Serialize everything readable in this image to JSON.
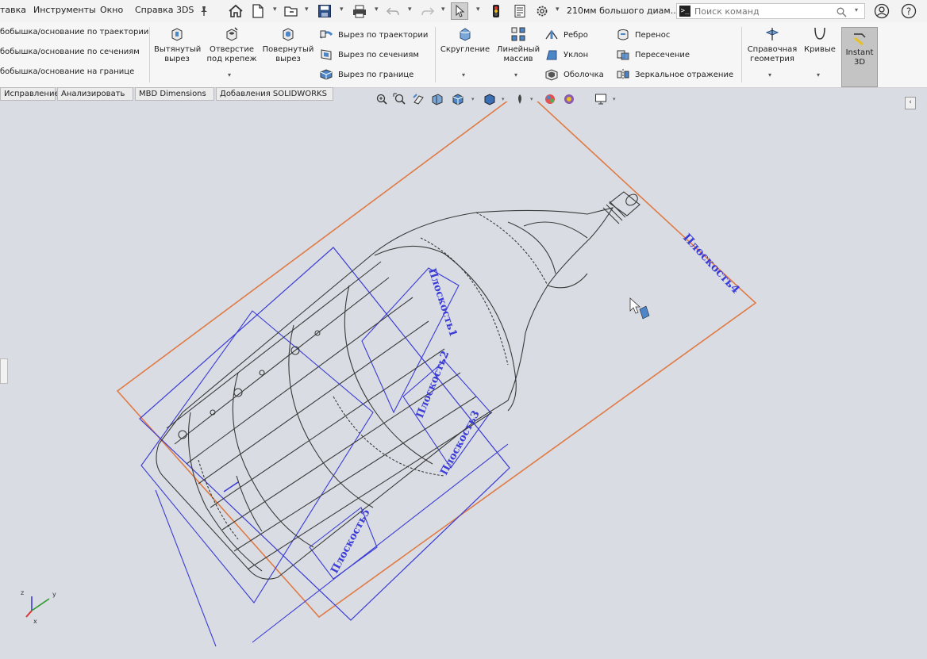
{
  "menu": [
    "тавка",
    "Инструменты",
    "Окно",
    "Справка 3DS"
  ],
  "document_title": "210мм большого диам...",
  "search": {
    "placeholder": "Поиск команд"
  },
  "ribbon": {
    "boss_items": [
      "бобышка/основание по траектории",
      "бобышка/основание по сечениям",
      "бобышка/основание на границе"
    ],
    "extruded_cut": [
      "Вытянутый",
      "вырез"
    ],
    "hole_wizard": [
      "Отверстие",
      "под крепеж"
    ],
    "revolved_cut": [
      "Повернутый",
      "вырез"
    ],
    "cut_items": [
      "Вырез по траектории",
      "Вырез по сечениям",
      "Вырез по границе"
    ],
    "fillet": "Скругление",
    "linear_pattern": [
      "Линейный",
      "массив"
    ],
    "features_col1": [
      "Ребро",
      "Уклон",
      "Оболочка"
    ],
    "features_col2": [
      "Перенос",
      "Пересечение",
      "Зеркальное отражение"
    ],
    "ref_geometry": [
      "Справочная",
      "геометрия"
    ],
    "curves": "Кривые",
    "instant3d": [
      "Instant",
      "3D"
    ]
  },
  "tabs": [
    "Исправление",
    "Анализировать",
    "MBD Dimensions",
    "Добавления SOLIDWORKS"
  ],
  "planes": {
    "p4": "Плоскость4",
    "p1": "Плоскость1",
    "p2": "Плоскость2",
    "p3": "Плоскость3",
    "p5": "Плоскость5"
  },
  "triad": {
    "x": "x",
    "y": "y",
    "z": "z"
  },
  "colors": {
    "plane_orange": "#e07a45",
    "plane_blue": "#3b3bd6",
    "model_line": "#3a3a3a",
    "viewport_bg": "#d9dde3"
  }
}
